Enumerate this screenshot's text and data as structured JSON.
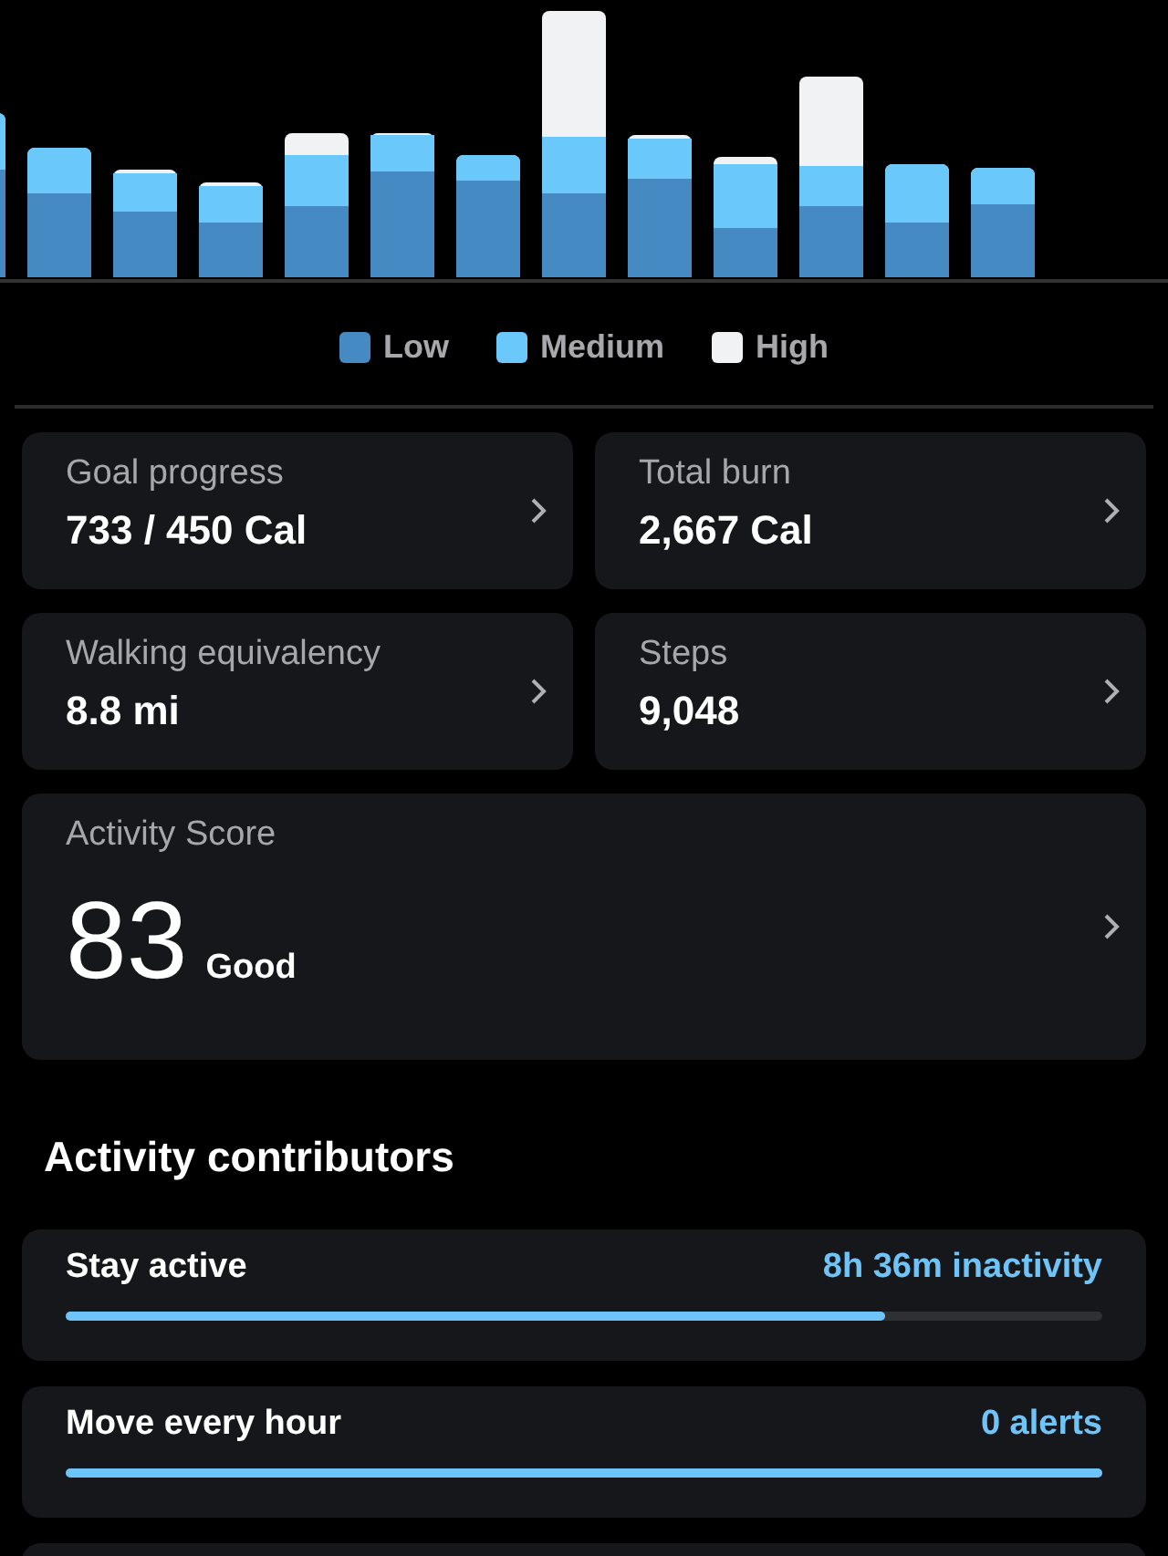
{
  "chart_legend": [
    {
      "label": "Low",
      "color": "#468ac4"
    },
    {
      "label": "Medium",
      "color": "#6ac8fb"
    },
    {
      "label": "High",
      "color": "#f0f2f4"
    }
  ],
  "stats": [
    {
      "label": "Goal progress",
      "value": "733 / 450 Cal"
    },
    {
      "label": "Total burn",
      "value": "2,667 Cal"
    },
    {
      "label": "Walking equivalency",
      "value": "8.8 mi"
    },
    {
      "label": "Steps",
      "value": "9,048"
    }
  ],
  "activity_score": {
    "label": "Activity Score",
    "value": "83",
    "rating": "Good"
  },
  "contributors_heading": "Activity contributors",
  "contributors": [
    {
      "label": "Stay active",
      "reading": "8h 36m inactivity",
      "level": 0.79
    },
    {
      "label": "Move every hour",
      "reading": "0 alerts",
      "level": 1
    }
  ]
}
